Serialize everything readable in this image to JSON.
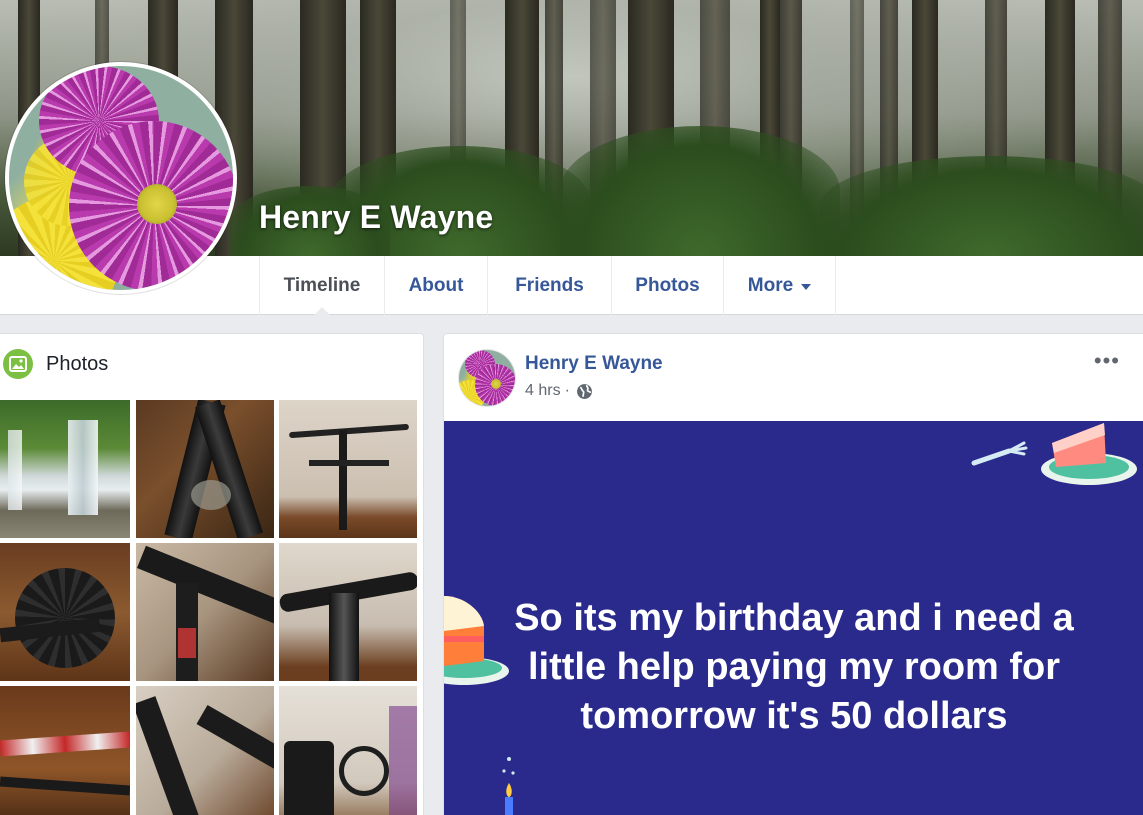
{
  "profile": {
    "name": "Henry E Wayne"
  },
  "nav": {
    "tabs": [
      {
        "label": "Timeline",
        "active": true
      },
      {
        "label": "About"
      },
      {
        "label": "Friends"
      },
      {
        "label": "Photos"
      },
      {
        "label": "More"
      }
    ]
  },
  "photos_section": {
    "title": "Photos",
    "icon": "photos-icon"
  },
  "post": {
    "author": "Henry E Wayne",
    "time": "4 hrs",
    "separator": "·",
    "privacy_icon": "globe-icon",
    "options_icon": "more-options-icon",
    "options_label": "•••",
    "text": "So its my birthday and i need a little help paying my room for tomorrow it's 50 dollars",
    "background_color": "#2a2a8c"
  },
  "colors": {
    "link_blue": "#365899",
    "photos_icon_green": "#7bc043",
    "page_bg": "#e9ebee"
  }
}
